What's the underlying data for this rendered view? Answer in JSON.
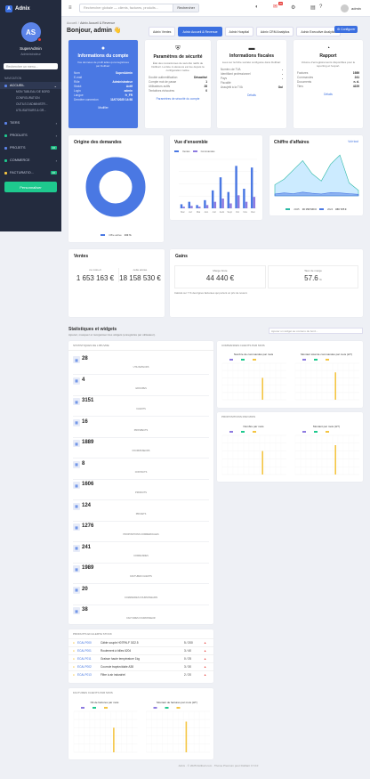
{
  "app": {
    "name": "Adnix"
  },
  "sidebar": {
    "initials": "AS",
    "user": "SuperAdmin",
    "role": "Administrateur",
    "search_placeholder": "Rechercher un menu...",
    "nav_label": "NAVIGATION",
    "items": [
      {
        "label": "ACCUEIL"
      },
      {
        "label": "TIERS"
      },
      {
        "label": "PRODUITS"
      },
      {
        "label": "PROJETS",
        "badge": "16"
      },
      {
        "label": "COMMERCE"
      },
      {
        "label": "FACTURATIO...",
        "badge": "10"
      }
    ],
    "subitems": [
      "MON TABLEAU DE BORD",
      "CONFIGURATION",
      "OUTILS D'ADMINISTR...",
      "UTILISATEURS & GR..."
    ],
    "customize": "Personnaliser"
  },
  "topbar": {
    "search_placeholder": "Rechercher globale — clients, factures, produits...",
    "search_button": "Rechercher",
    "notif_count": "20",
    "user": "admin"
  },
  "breadcrumb": {
    "home": "Accueil",
    "sep": "/",
    "current": "Adnix Accueil & Revenue"
  },
  "greeting": "Bonjour, admin 👋",
  "tabs": [
    "Adnix Ventes",
    "Adnix Accueil & Revenue",
    "Adnix Hospital",
    "Adnix CRM Analytics",
    "Adnix Executive Analytics"
  ],
  "configure_button": "Configurer",
  "account": {
    "title": "Informations du compte",
    "desc": "Vos données de profil telles qu'enregistrées par Dolibarr.",
    "rows": [
      [
        "Nom",
        "SuperAdmin"
      ],
      [
        "E-mail",
        ""
      ],
      [
        "Rôle",
        "Administrateur"
      ],
      [
        "Statut",
        "Actif"
      ],
      [
        "Login",
        "admin"
      ],
      [
        "Langue",
        "fr_FR"
      ],
      [
        "Dernière connexion",
        "11/07/2025 14:58"
      ]
    ],
    "link": "Modifier"
  },
  "security": {
    "title": "Paramètres de sécurité",
    "desc": "État des mécanismes de sécurité natifs de Dolibarr. La liste ci-dessous est lue depuis la configuration native.",
    "rows": [
      [
        "Double authentification",
        "Désactivé"
      ],
      [
        "Compte mot de passe",
        "1"
      ],
      [
        "Utilisateurs actifs",
        "28"
      ],
      [
        "Tentatives échouées",
        "0"
      ]
    ],
    "link": "Paramètres de sécurité du compte"
  },
  "fiscal": {
    "title": "Informations fiscales",
    "desc": "Lues sur la fiche société configurée dans Dolibarr.",
    "rows": [
      [
        "Numéro de TVA",
        "-"
      ],
      [
        "Identifiant professionnel",
        "-"
      ],
      [
        "Pays",
        "-"
      ],
      [
        "Fiscalité",
        ""
      ],
      [
        "Assujetti à la TVA",
        "Oui"
      ]
    ],
    "link": "Détails"
  },
  "report": {
    "title": "Rapport",
    "desc": "Volume d'enregistrements disponibles pour le reporting et l'export.",
    "rows": [
      [
        "Factures",
        "1989"
      ],
      [
        "Commandes",
        "241"
      ],
      [
        "Documents",
        "n. d."
      ],
      [
        "Tiers",
        "4229"
      ]
    ],
    "link": "Détails"
  },
  "demand": {
    "title": "Origine des demandes",
    "center_label": "Web/Mobile",
    "center_value": "100 %",
    "legend": "Offre active",
    "legend_value": "100 %"
  },
  "overview": {
    "title": "Vue d'ensemble",
    "legend": [
      "Ventes",
      "Commandes"
    ]
  },
  "revenue": {
    "title": "Chiffre d'affaires",
    "link": "Voir tout",
    "legend": [
      [
        "2025",
        "18 158 530 €"
      ],
      [
        "2024",
        "960 725 €"
      ]
    ]
  },
  "sales": {
    "title": "Ventes",
    "month_label": "ce mois-ci",
    "month_value": "1 653 163 €",
    "year_label": "cette année",
    "year_value": "18 158 530 €"
  },
  "gains": {
    "title": "Gains",
    "gross_label": "Marge brute",
    "gross_value": "44 440 €",
    "rate_label": "Taux de marge",
    "rate_value": "57.6",
    "rate_unit": "%",
    "note": "Calculé sur 7 % des lignes facturées qui portent un prix de revient."
  },
  "widgets": {
    "title": "Statistiques et widgets",
    "subtitle": "Ajoutez, masquez et réorganisez des widgets (enregistrés par utilisateur).",
    "add_placeholder": "Ajouter un widget au contenu de bord..."
  },
  "stats_widget": {
    "title": "STATISTIQUES DE L'ŒUVRE",
    "items": [
      [
        "28",
        "UTILISATEURS"
      ],
      [
        "4",
        "GROUPES"
      ],
      [
        "3151",
        "CLIENTS"
      ],
      [
        "16",
        "PROSPECTS"
      ],
      [
        "1889",
        "FOURNISSEURS"
      ],
      [
        "8",
        "CONTACTS"
      ],
      [
        "1606",
        "PRODUITS"
      ],
      [
        "124",
        "PROJETS"
      ],
      [
        "1276",
        "PROPOSITIONS COMMERCIALES"
      ],
      [
        "241",
        "COMMANDES"
      ],
      [
        "1989",
        "FACTURES CLIENTS"
      ],
      [
        "20",
        "COMMANDES FOURNISSEURS"
      ],
      [
        "38",
        "FACTURES FOURNISSEUR"
      ]
    ]
  },
  "orders_widget": {
    "title": "COMMANDES CLIENTS PAR MOIS",
    "c1": "Nombre de commandes par mois",
    "c2": "Montant total de commandes par mois (HT)",
    "legend": [
      "2024",
      "2025",
      "2026"
    ]
  },
  "proposals_widget": {
    "title": "PROPOSITIONS PAR MOIS",
    "c1": "Nombre par mois",
    "c2": "Montant par mois (HT)",
    "legend": [
      "2024",
      "2025",
      "2026"
    ]
  },
  "stock_widget": {
    "title": "PRODUITS EN ALERTE STOCK",
    "rows": [
      [
        "ECAi-P000",
        "Câble souple H07RN-F 3G2.5",
        "5 / 200"
      ],
      [
        "ECAi-P001",
        "Roulement à billes 6204",
        "3 / 40"
      ],
      [
        "ECAi-P011",
        "Graisse haute température 1kg",
        "0 / 25"
      ],
      [
        "ECAi-P002",
        "Courroie trapézoïdale A38",
        "3 / 30"
      ],
      [
        "ECAi-P013",
        "Filtre à air industriel",
        "2 / 20"
      ]
    ]
  },
  "invoices_widget": {
    "title": "FACTURES CLIENTS PAR MOIS",
    "c1": "Nb de factures par mois",
    "c2": "Montant de factures par mois (HT)",
    "legend": [
      "2024",
      "2025",
      "2026"
    ]
  },
  "footer": "Adnix · © 2025 Dolibarr.com · Thème Premium pour Dolibarr 17.0.0",
  "colors": {
    "accent": "#3b6fe0",
    "sidebar": "#232b3e",
    "green": "#1ec98e",
    "red": "#e53935",
    "yellow": "#f4c542",
    "purple": "#8e7be0",
    "teal": "#2bb8a5"
  },
  "chart_data": [
    {
      "type": "pie",
      "title": "Origine des demandes",
      "categories": [
        "Offre active"
      ],
      "values": [
        100
      ]
    },
    {
      "type": "bar",
      "title": "Vue d'ensemble",
      "categories": [
        "Mar",
        "Avr",
        "Mai",
        "Juin",
        "Juil",
        "Août",
        "Sept",
        "Oct",
        "Nov",
        "Déc"
      ],
      "series": [
        {
          "name": "Ventes",
          "values": [
            5,
            8,
            4,
            10,
            22,
            38,
            20,
            52,
            24,
            50
          ]
        },
        {
          "name": "Commandes",
          "values": [
            2,
            3,
            2,
            4,
            8,
            12,
            6,
            16,
            8,
            14
          ]
        }
      ]
    },
    {
      "type": "area",
      "title": "Chiffre d'affaires",
      "series": [
        {
          "name": "2025",
          "values": [
            30,
            45,
            70,
            95,
            60,
            40,
            85,
            110,
            35,
            15
          ]
        },
        {
          "name": "2024",
          "values": [
            5,
            8,
            6,
            10,
            7,
            5,
            9,
            8,
            6,
            4
          ]
        }
      ]
    }
  ]
}
